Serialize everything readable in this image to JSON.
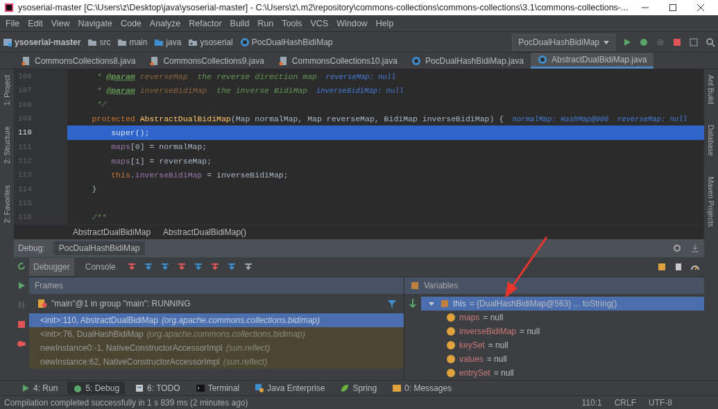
{
  "window": {
    "title": "ysoserial-master [C:\\Users\\z\\Desktop\\java\\ysoserial-master] - C:\\Users\\z\\.m2\\repository\\commons-collections\\commons-collections\\3.1\\commons-collections-..."
  },
  "menu": [
    "File",
    "Edit",
    "View",
    "Navigate",
    "Code",
    "Analyze",
    "Refactor",
    "Build",
    "Run",
    "Tools",
    "VCS",
    "Window",
    "Help"
  ],
  "navbar": {
    "crumbs": [
      {
        "label": "ysoserial-master",
        "kind": "project"
      },
      {
        "label": "src",
        "kind": "folder"
      },
      {
        "label": "main",
        "kind": "folder"
      },
      {
        "label": "java",
        "kind": "source"
      },
      {
        "label": "ysoserial",
        "kind": "package"
      },
      {
        "label": "PocDualHashBidiMap",
        "kind": "class"
      }
    ],
    "run_config": "PocDualHashBidiMap"
  },
  "tabs": [
    {
      "label": "CommonsCollections8.java",
      "kind": "java",
      "selected": false
    },
    {
      "label": "CommonsCollections9.java",
      "kind": "java",
      "selected": false
    },
    {
      "label": "CommonsCollections10.java",
      "kind": "java",
      "selected": false
    },
    {
      "label": "PocDualHashBidiMap.java",
      "kind": "class",
      "selected": false
    },
    {
      "label": "AbstractDualBidiMap.java",
      "kind": "class",
      "selected": true
    }
  ],
  "left_strip": [
    "1: Project",
    "2: Structure",
    "2: Favorites"
  ],
  "right_strip": [
    "Ant Build",
    "Database",
    "Maven Projects"
  ],
  "editor": {
    "lines": [
      {
        "number": "106",
        "selected": false,
        "tokens": [
          {
            "text": "     * ",
            "kind": "comment"
          },
          {
            "text": "@param",
            "kind": "tag"
          },
          {
            "text": " reverseMap",
            "kind": "param"
          },
          {
            "text": "  the reverse direction map",
            "kind": "comment"
          },
          {
            "text": "  reverseMap: null",
            "kind": "hint"
          }
        ]
      },
      {
        "number": "107",
        "selected": false,
        "tokens": [
          {
            "text": "     * ",
            "kind": "comment"
          },
          {
            "text": "@param",
            "kind": "tag"
          },
          {
            "text": " inverseBidiMap",
            "kind": "param"
          },
          {
            "text": "  the inverse BidiMap",
            "kind": "comment"
          },
          {
            "text": "  inverseBidiMap: null",
            "kind": "hint"
          }
        ]
      },
      {
        "number": "108",
        "selected": false,
        "tokens": [
          {
            "text": "     */",
            "kind": "comment"
          }
        ]
      },
      {
        "number": "109",
        "selected": false,
        "tokens": [
          {
            "text": "    protected ",
            "kind": "keyword"
          },
          {
            "text": "AbstractDualBidiMap",
            "kind": "fn"
          },
          {
            "text": "(Map normalMap, Map reverseMap, BidiMap inverseBidiMap) {",
            "kind": "plain"
          },
          {
            "text": "  normalMap: HashMap@900  reverseMap: null",
            "kind": "hint"
          }
        ]
      },
      {
        "number": "110",
        "selected": true,
        "tokens": [
          {
            "text": "        super();",
            "kind": "keyword"
          }
        ]
      },
      {
        "number": "111",
        "selected": false,
        "tokens": [
          {
            "text": "        maps",
            "kind": "field"
          },
          {
            "text": "[0] = normalMap;",
            "kind": "plain"
          }
        ]
      },
      {
        "number": "112",
        "selected": false,
        "tokens": [
          {
            "text": "        maps",
            "kind": "field"
          },
          {
            "text": "[1] = reverseMap;",
            "kind": "plain"
          }
        ]
      },
      {
        "number": "113",
        "selected": false,
        "tokens": [
          {
            "text": "        this",
            "kind": "keyword"
          },
          {
            "text": ".",
            "kind": "plain"
          },
          {
            "text": "inverseBidiMap",
            "kind": "field"
          },
          {
            "text": " = inverseBidiMap;",
            "kind": "plain"
          }
        ]
      },
      {
        "number": "114",
        "selected": false,
        "tokens": [
          {
            "text": "    }",
            "kind": "plain"
          }
        ]
      },
      {
        "number": "115",
        "selected": false
      },
      {
        "number": "116",
        "selected": false,
        "tokens": [
          {
            "text": "    /**",
            "kind": "comment"
          }
        ]
      }
    ]
  },
  "breadcrumb": [
    "AbstractDualBidiMap",
    "AbstractDualBidiMap()"
  ],
  "debug": {
    "label": "Debug:",
    "session": "PocDualHashBidiMap",
    "tabs": [
      {
        "label": "Debugger",
        "selected": true
      },
      {
        "label": "Console",
        "selected": false
      }
    ],
    "frames": {
      "title": "Frames",
      "thread": "\"main\"@1 in group \"main\": RUNNING",
      "rows": [
        {
          "method": "<init>:110, AbstractDualBidiMap",
          "package": "(org.apache.commons.collections.bidimap)",
          "selected": true
        },
        {
          "method": "<init>:76, DualHashBidiMap",
          "package": "(org.apache.commons.collections.bidimap)",
          "selected": false
        },
        {
          "method": "newInstance0:-1, NativeConstructorAccessorImpl",
          "package": "(sun.reflect)",
          "selected": false
        },
        {
          "method": "newInstance:62, NativeConstructorAccessorImpl",
          "package": "(sun.reflect)",
          "selected": false
        }
      ]
    },
    "variables": {
      "title": "Variables",
      "tree": [
        {
          "name": "this",
          "value": "= {DualHashBidiMap@563} ... toString()",
          "selected": true,
          "expanded": true,
          "children": [
            {
              "name": "maps",
              "value": "= null",
              "selected": false
            },
            {
              "name": "inverseBidiMap",
              "value": "= null",
              "selected": false
            },
            {
              "name": "keySet",
              "value": "= null",
              "selected": false
            },
            {
              "name": "values",
              "value": "= null",
              "selected": false
            },
            {
              "name": "entrySet",
              "value": "= null",
              "selected": false
            }
          ]
        }
      ]
    }
  },
  "tool_tabs": [
    {
      "label": "4: Run",
      "kind": "run",
      "selected": false
    },
    {
      "label": "5: Debug",
      "kind": "debug",
      "selected": true
    },
    {
      "label": "6: TODO",
      "kind": "todo",
      "selected": false
    },
    {
      "label": "Terminal",
      "kind": "terminal",
      "selected": false
    },
    {
      "label": "Java Enterprise",
      "kind": "enterprise",
      "selected": false
    },
    {
      "label": "Spring",
      "kind": "spring",
      "selected": false
    },
    {
      "label": "0: Messages",
      "kind": "messages",
      "selected": false
    }
  ],
  "status_bar": {
    "message": "Compilation completed successfully in 1 s 839 ms (2 minutes ago)",
    "position": "110:1",
    "line_separator": "CRLF",
    "encoding": "UTF-8"
  }
}
